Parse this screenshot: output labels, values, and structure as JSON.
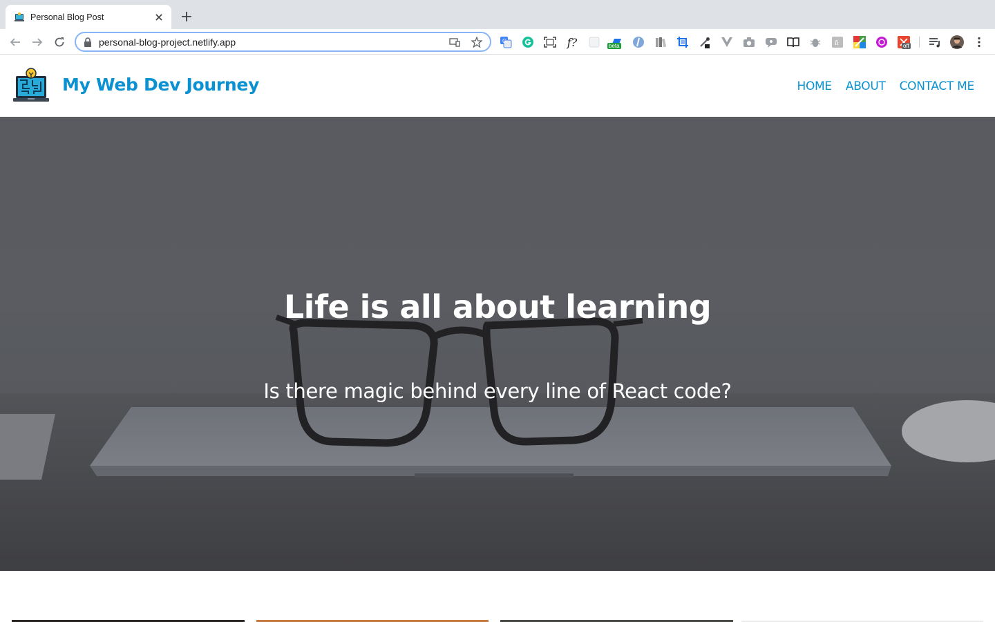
{
  "browser": {
    "tab": {
      "title": "Personal Blog Post",
      "favicon": "laptop-maze-icon"
    },
    "new_tab_icon": "plus-icon",
    "close_icon": "close-icon",
    "address": {
      "url": "personal-blog-project.netlify.app",
      "lock_icon": "lock-icon"
    },
    "extensions": [
      {
        "name": "translate-icon"
      },
      {
        "name": "grammarly-icon"
      },
      {
        "name": "screenshot-frame-icon"
      },
      {
        "name": "whatfont-icon",
        "text": "f?"
      },
      {
        "name": "blank-ext-icon"
      },
      {
        "name": "beta-ext-icon",
        "badge": "beta"
      },
      {
        "name": "opera-ext-icon"
      },
      {
        "name": "books-icon"
      },
      {
        "name": "crop-icon"
      },
      {
        "name": "eyedropper-icon"
      },
      {
        "name": "vue-devtools-icon"
      },
      {
        "name": "camera-icon"
      },
      {
        "name": "chat-ext-icon"
      },
      {
        "name": "reader-icon"
      },
      {
        "name": "bug-icon"
      },
      {
        "name": "font-ext-icon"
      },
      {
        "name": "color-grid-icon"
      },
      {
        "name": "purple-circle-icon"
      },
      {
        "name": "off-ext-icon",
        "badge": "off"
      },
      {
        "name": "playlist-icon"
      },
      {
        "name": "profile-avatar-icon"
      },
      {
        "name": "more-menu-icon"
      }
    ]
  },
  "site": {
    "title": "My Web Dev Journey",
    "logo": "laptop-maze-logo",
    "nav": [
      "HOME",
      "ABOUT",
      "CONTACT ME"
    ],
    "hero": {
      "title": "Life is all about learning",
      "subtitle": "Is there magic behind every line of React code?"
    }
  },
  "colors": {
    "brand": "#0b91d1",
    "chrome_tabstrip": "#dee1e6",
    "focus_ring": "#8ab4f8"
  }
}
